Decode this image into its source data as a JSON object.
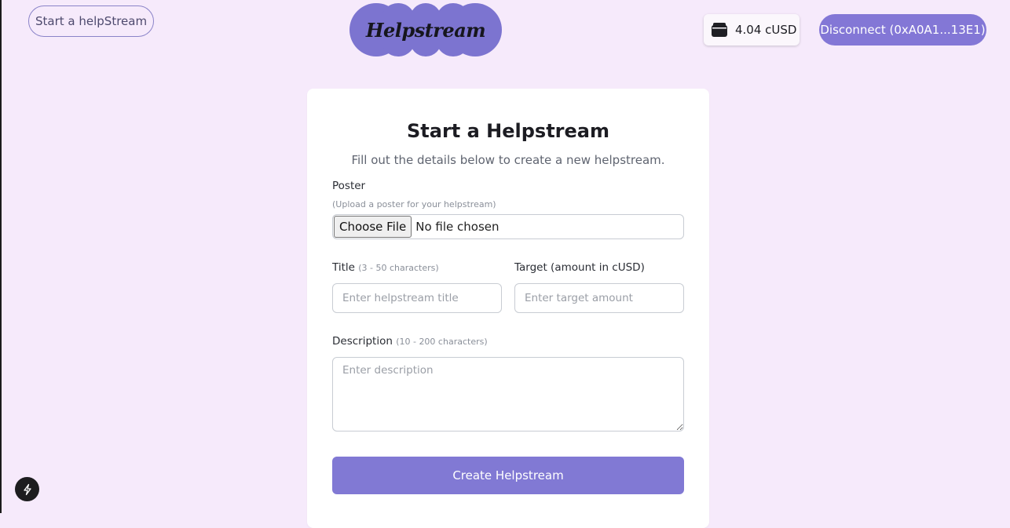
{
  "header": {
    "start_link_label": "Start a helpStream",
    "logo_text": "Helpstream",
    "balance": "4.04 cUSD",
    "wallet_icon": "wallet-icon",
    "disconnect_label": "Disconnect (0xA0A1...13E1)"
  },
  "form": {
    "title": "Start a Helpstream",
    "subtitle": "Fill out the details below to create a new helpstream.",
    "poster": {
      "label": "Poster",
      "hint": "(Upload a poster for your helpstream)",
      "button_label": "Choose File",
      "status": "No file chosen"
    },
    "title_field": {
      "label": "Title",
      "hint": "(3 - 50 characters)",
      "placeholder": "Enter helpstream title",
      "value": ""
    },
    "target_field": {
      "label": "Target (amount in cUSD)",
      "placeholder": "Enter target amount",
      "value": ""
    },
    "description_field": {
      "label": "Description",
      "hint": "(10 - 200 characters)",
      "placeholder": "Enter description",
      "value": ""
    },
    "submit_label": "Create Helpstream"
  },
  "dev_indicator": {
    "icon": "bolt-icon"
  },
  "colors": {
    "background": "#f6eafb",
    "accent": "#8179d4",
    "logo_cloud": "#7c74d0"
  }
}
